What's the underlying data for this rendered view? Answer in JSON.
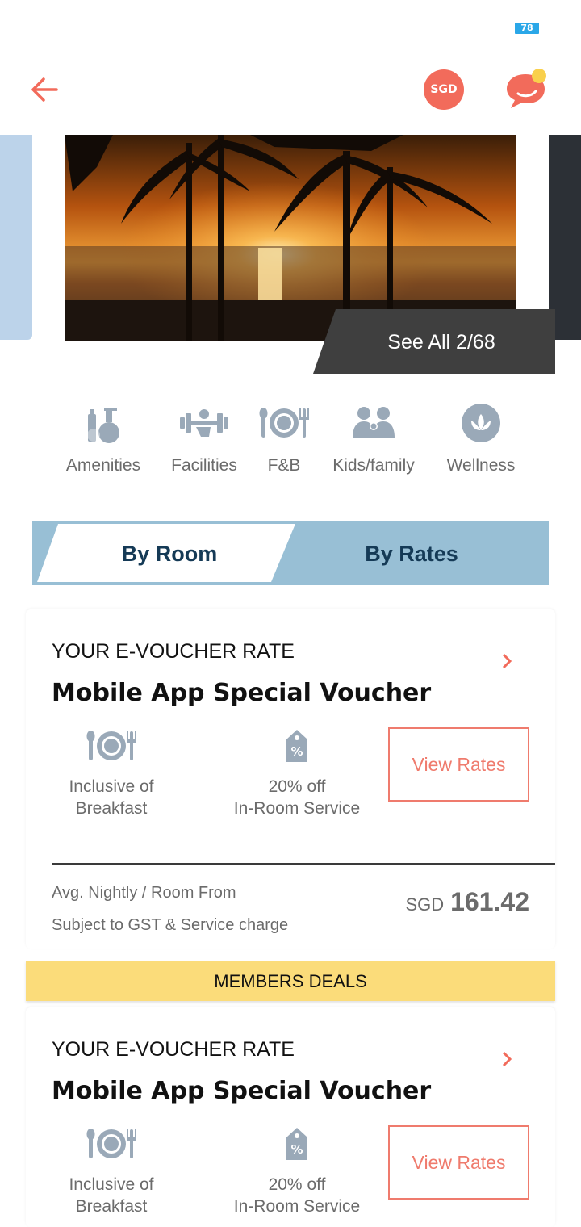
{
  "status_bar": {
    "battery_level": "78"
  },
  "header": {
    "currency_label": "SGD"
  },
  "gallery": {
    "see_all_label": "See All 2/68"
  },
  "categories": [
    {
      "label": "Amenities",
      "icon": "amenities-icon"
    },
    {
      "label": "Facilities",
      "icon": "dumbbell-icon"
    },
    {
      "label": "F&B",
      "icon": "plate-cutlery-icon"
    },
    {
      "label": "Kids/family",
      "icon": "family-icon"
    },
    {
      "label": "Wellness",
      "icon": "lotus-icon"
    }
  ],
  "toggle": {
    "by_room": "By Room",
    "by_rates": "By Rates",
    "active": "By Room"
  },
  "rate_cards": [
    {
      "kicker": "YOUR E-VOUCHER RATE",
      "title": "Mobile App Special Voucher",
      "perk1_line1": "Inclusive of",
      "perk1_line2": "Breakfast",
      "perk2_line1": "20% off",
      "perk2_line2": "In-Room Service",
      "view_rates": "View Rates",
      "avg_label": "Avg. Nightly / Room From",
      "tax_label": "Subject to GST & Service charge",
      "currency": "SGD",
      "amount": "161.42"
    },
    {
      "kicker": "YOUR E-VOUCHER RATE",
      "title": "Mobile App Special Voucher",
      "perk1_line1": "Inclusive of",
      "perk1_line2": "Breakfast",
      "perk2_line1": "20% off",
      "perk2_line2": "In-Room Service",
      "view_rates": "View Rates"
    }
  ],
  "members_deals": "MEMBERS DEALS",
  "colors": {
    "accent": "#f26b5b",
    "toggle_blue": "#98bfd5",
    "toggle_text": "#153a56",
    "members_yellow": "#fbdc7a",
    "icon_grey": "#9aa9b8"
  }
}
